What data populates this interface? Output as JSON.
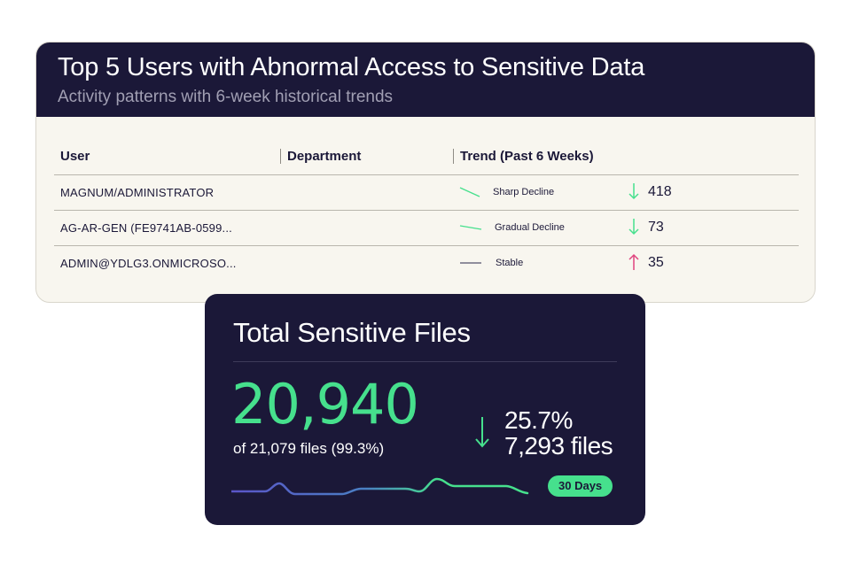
{
  "top_card": {
    "title": "Top 5 Users with Abnormal Access to Sensitive Data",
    "subtitle": "Activity patterns with 6-week historical trends",
    "columns": [
      "User",
      "Department",
      "Trend (Past 6 Weeks)"
    ],
    "rows": [
      {
        "user": "MAGNUM/ADMINISTRATOR",
        "department": "",
        "trend": "Sharp Decline",
        "direction": "down",
        "count": "418"
      },
      {
        "user": "AG-AR-GEN (FE9741AB-0599...",
        "department": "",
        "trend": "Gradual Decline",
        "direction": "down",
        "count": "73"
      },
      {
        "user": "ADMIN@YDLG3.ONMICROSO...",
        "department": "",
        "trend": "Stable",
        "direction": "up",
        "count": "35"
      }
    ]
  },
  "bottom_card": {
    "title": "Total Sensitive Files",
    "value": "20,940",
    "subtext": "of 21,079 files (99.3%)",
    "change_percent": "25.7%",
    "change_files": "7,293 files",
    "badge": "30 Days"
  },
  "colors": {
    "navy": "#1b1838",
    "green": "#46e08d",
    "pink": "#e0447f",
    "purple": "#5b55c8",
    "card_bg": "#f8f6ef"
  }
}
